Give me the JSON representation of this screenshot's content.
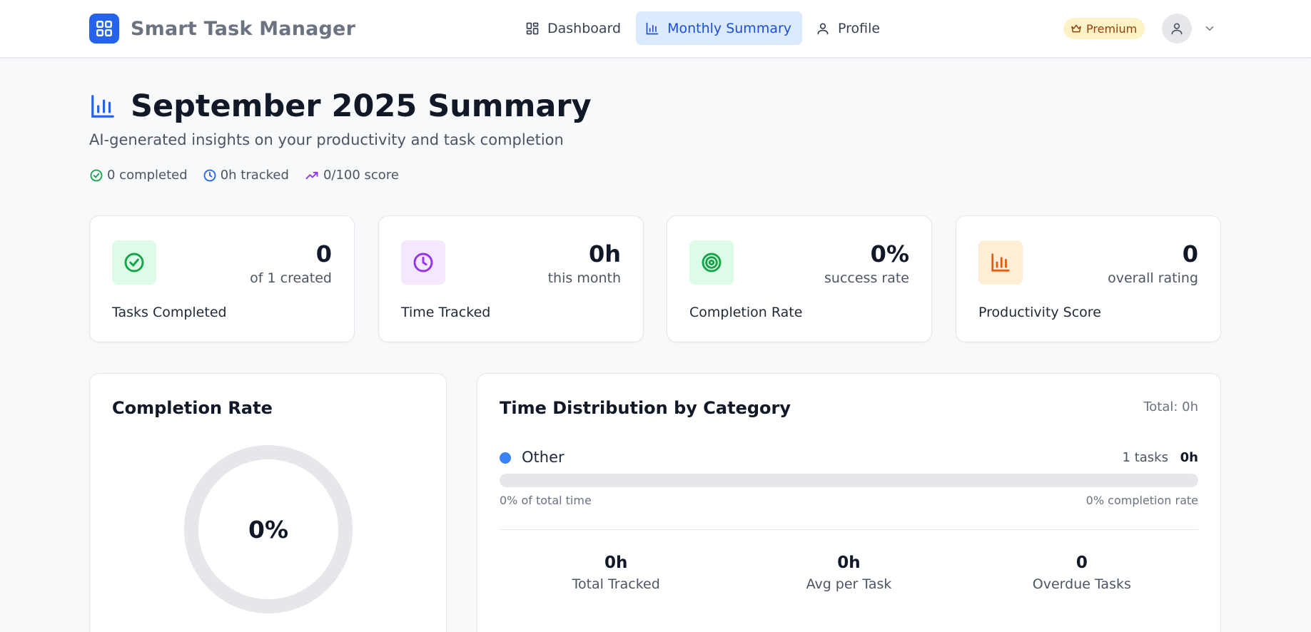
{
  "brand": {
    "name": "Smart Task Manager",
    "logo_icon": "grid-icon"
  },
  "nav": [
    {
      "label": "Dashboard",
      "icon": "dashboard-icon",
      "active": false
    },
    {
      "label": "Monthly Summary",
      "icon": "bar-chart-icon",
      "active": true
    },
    {
      "label": "Profile",
      "icon": "user-icon",
      "active": false
    }
  ],
  "header": {
    "badge": "Premium",
    "badge_icon": "crown-icon"
  },
  "page": {
    "title": "September 2025 Summary",
    "subtitle": "AI-generated insights on your productivity and task completion",
    "quick_stats": {
      "completed": "0 completed",
      "tracked": "0h tracked",
      "score": "0/100 score"
    }
  },
  "stats": [
    {
      "value": "0",
      "sub": "of 1 created",
      "label": "Tasks Completed",
      "icon": "check-circle-icon",
      "color": "#16a34a",
      "bg": "#dcfce7"
    },
    {
      "value": "0h",
      "sub": "this month",
      "label": "Time Tracked",
      "icon": "clock-icon",
      "color": "#9333ea",
      "bg": "#f3e8ff"
    },
    {
      "value": "0%",
      "sub": "success rate",
      "label": "Completion Rate",
      "icon": "target-icon",
      "color": "#16a34a",
      "bg": "#dcfce7"
    },
    {
      "value": "0",
      "sub": "overall rating",
      "label": "Productivity Score",
      "icon": "bar-chart-icon",
      "color": "#ea580c",
      "bg": "#ffedd5"
    }
  ],
  "completion": {
    "title": "Completion Rate",
    "value": "0%",
    "fraction": 0
  },
  "time_distribution": {
    "title": "Time Distribution by Category",
    "total": "Total: 0h",
    "categories": [
      {
        "name": "Other",
        "tasks": "1 tasks",
        "hours": "0h",
        "share": "0% of total time",
        "rate": "0% completion rate",
        "fraction": 0,
        "color": "#3b82f6"
      }
    ],
    "summary": [
      {
        "value": "0h",
        "label": "Total Tracked"
      },
      {
        "value": "0h",
        "label": "Avg per Task"
      },
      {
        "value": "0",
        "label": "Overdue Tasks"
      }
    ]
  }
}
